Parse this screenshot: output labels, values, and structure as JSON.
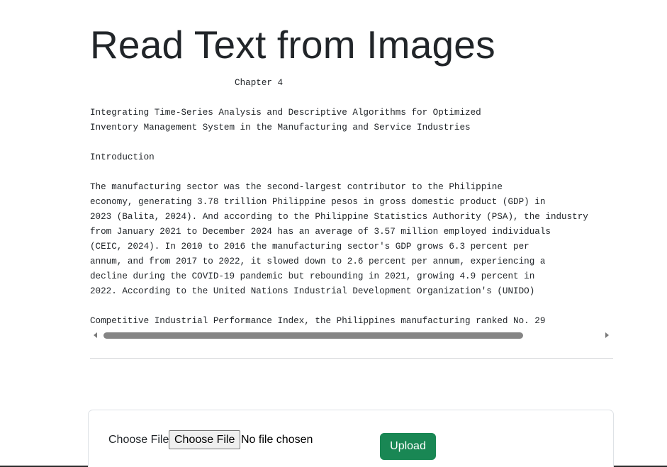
{
  "page": {
    "title": "Read Text from Images"
  },
  "ocr": {
    "lines": [
      "                           Chapter 4",
      "",
      "Integrating Time-Series Analysis and Descriptive Algorithms for Optimized",
      "Inventory Management System in the Manufacturing and Service Industries",
      "",
      "Introduction",
      "",
      "The manufacturing sector was the second-largest contributor to the Philippine",
      "economy, generating 3.78 trillion Philippine pesos in gross domestic product (GDP) in",
      "2023 (Balita, 2024). And according to the Philippine Statistics Authority (PSA), the industry",
      "from January 2021 to December 2024 has an average of 3.57 million employed individuals",
      "(CEIC, 2024). In 2010 to 2016 the manufacturing sector's GDP grows 6.3 percent per",
      "annum, and from 2017 to 2022, it slowed down to 2.6 percent per annum, experiencing a",
      "decline during the COVID-19 pandemic but rebounding in 2021, growing 4.9 percent in",
      "2022. According to the United Nations Industrial Development Organization's (UNIDO)",
      "",
      "Competitive Industrial Performance Index, the Philippines manufacturing ranked No. 29"
    ]
  },
  "upload": {
    "label": "Choose File",
    "button_label": "Choose File",
    "status": "No file chosen",
    "submit_label": "Upload"
  },
  "colors": {
    "upload_button": "#198754",
    "text": "#212529"
  }
}
